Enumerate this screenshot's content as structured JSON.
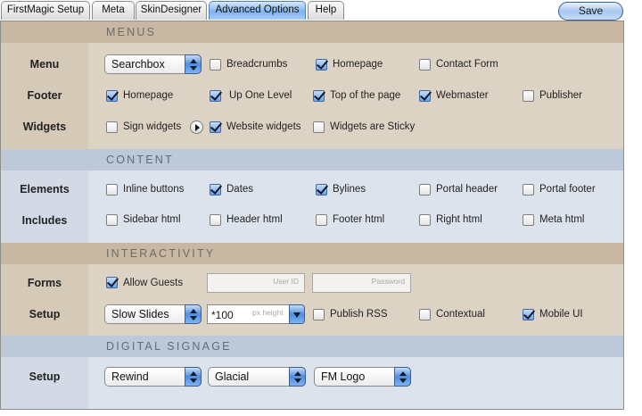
{
  "tabs": [
    {
      "label": "FirstMagic Setup",
      "active": false
    },
    {
      "label": "Meta",
      "active": false
    },
    {
      "label": "SkinDesigner",
      "active": false
    },
    {
      "label": "Advanced Options",
      "active": true
    },
    {
      "label": "Help",
      "active": false
    }
  ],
  "save_label": "Save",
  "sections": {
    "menus": "MENUS",
    "content": "CONTENT",
    "interactivity": "INTERACTIVITY",
    "signage": "DIGITAL SIGNAGE"
  },
  "rows": {
    "menu": {
      "label": "Menu",
      "select": "Searchbox",
      "checks": [
        {
          "label": "Breadcrumbs",
          "checked": false
        },
        {
          "label": "Homepage",
          "checked": true
        },
        {
          "label": "Contact Form",
          "checked": false
        }
      ]
    },
    "footer": {
      "label": "Footer",
      "checks": [
        {
          "label": "Homepage",
          "checked": true
        },
        {
          "label": "Up One Level",
          "checked": true
        },
        {
          "label": "Top of the page",
          "checked": true
        },
        {
          "label": "Webmaster",
          "checked": true
        },
        {
          "label": "Publisher",
          "checked": false
        }
      ]
    },
    "widgets": {
      "label": "Widgets",
      "checks": [
        {
          "label": "Sign widgets",
          "checked": false
        },
        {
          "label": "Website widgets",
          "checked": true
        },
        {
          "label": "Widgets are Sticky",
          "checked": false
        }
      ]
    },
    "elements": {
      "label": "Elements",
      "checks": [
        {
          "label": "Inline buttons",
          "checked": false
        },
        {
          "label": "Dates",
          "checked": true
        },
        {
          "label": "Bylines",
          "checked": true
        },
        {
          "label": "Portal header",
          "checked": false
        },
        {
          "label": "Portal footer",
          "checked": false
        }
      ]
    },
    "includes": {
      "label": "Includes",
      "checks": [
        {
          "label": "Sidebar html",
          "checked": false
        },
        {
          "label": "Header html",
          "checked": false
        },
        {
          "label": "Footer html",
          "checked": false
        },
        {
          "label": "Right html",
          "checked": false
        },
        {
          "label": "Meta html",
          "checked": false
        }
      ]
    },
    "forms": {
      "label": "Forms",
      "checks": [
        {
          "label": "Allow Guests",
          "checked": true
        }
      ],
      "userid_placeholder": "User ID",
      "password_placeholder": "Password"
    },
    "setup": {
      "label": "Setup",
      "select": "Slow Slides",
      "combo_value": "*100",
      "combo_placeholder": "px height",
      "checks": [
        {
          "label": "Publish RSS",
          "checked": false
        },
        {
          "label": "Contextual",
          "checked": false
        },
        {
          "label": "Mobile UI",
          "checked": true
        }
      ]
    },
    "signage": {
      "label": "Setup",
      "selects": [
        "Rewind",
        "Glacial",
        "FM Logo"
      ]
    }
  },
  "colors": {
    "tan_band": "#ddd3c5",
    "blue_band": "#dde3ec",
    "accent": "#4f8ee0"
  }
}
